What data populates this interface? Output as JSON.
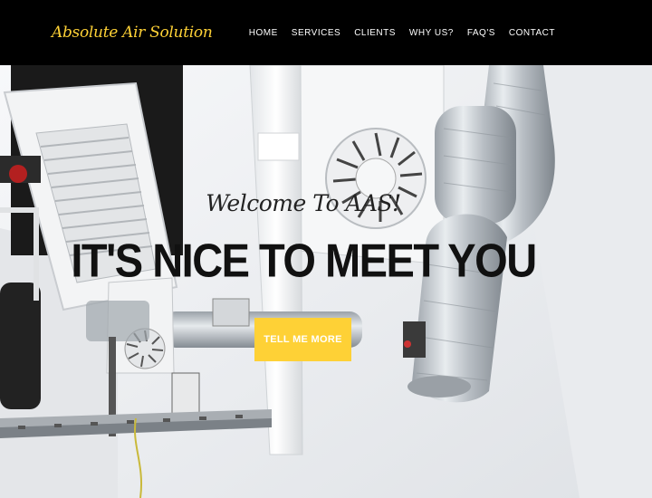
{
  "brand": {
    "name": "Absolute Air Solution"
  },
  "nav": {
    "items": [
      {
        "label": "HOME"
      },
      {
        "label": "SERVICES"
      },
      {
        "label": "CLIENTS"
      },
      {
        "label": "WHY US?"
      },
      {
        "label": "FAQ'S"
      },
      {
        "label": "CONTACT"
      }
    ]
  },
  "hero": {
    "lead_in": "Welcome To AAS!",
    "heading": "IT'S NICE TO MEET YOU",
    "button_label": "TELL ME MORE"
  },
  "colors": {
    "navbar_bg": "#000000",
    "brand": "#fed136",
    "button_bg": "#fed136",
    "button_text": "#ffffff"
  }
}
